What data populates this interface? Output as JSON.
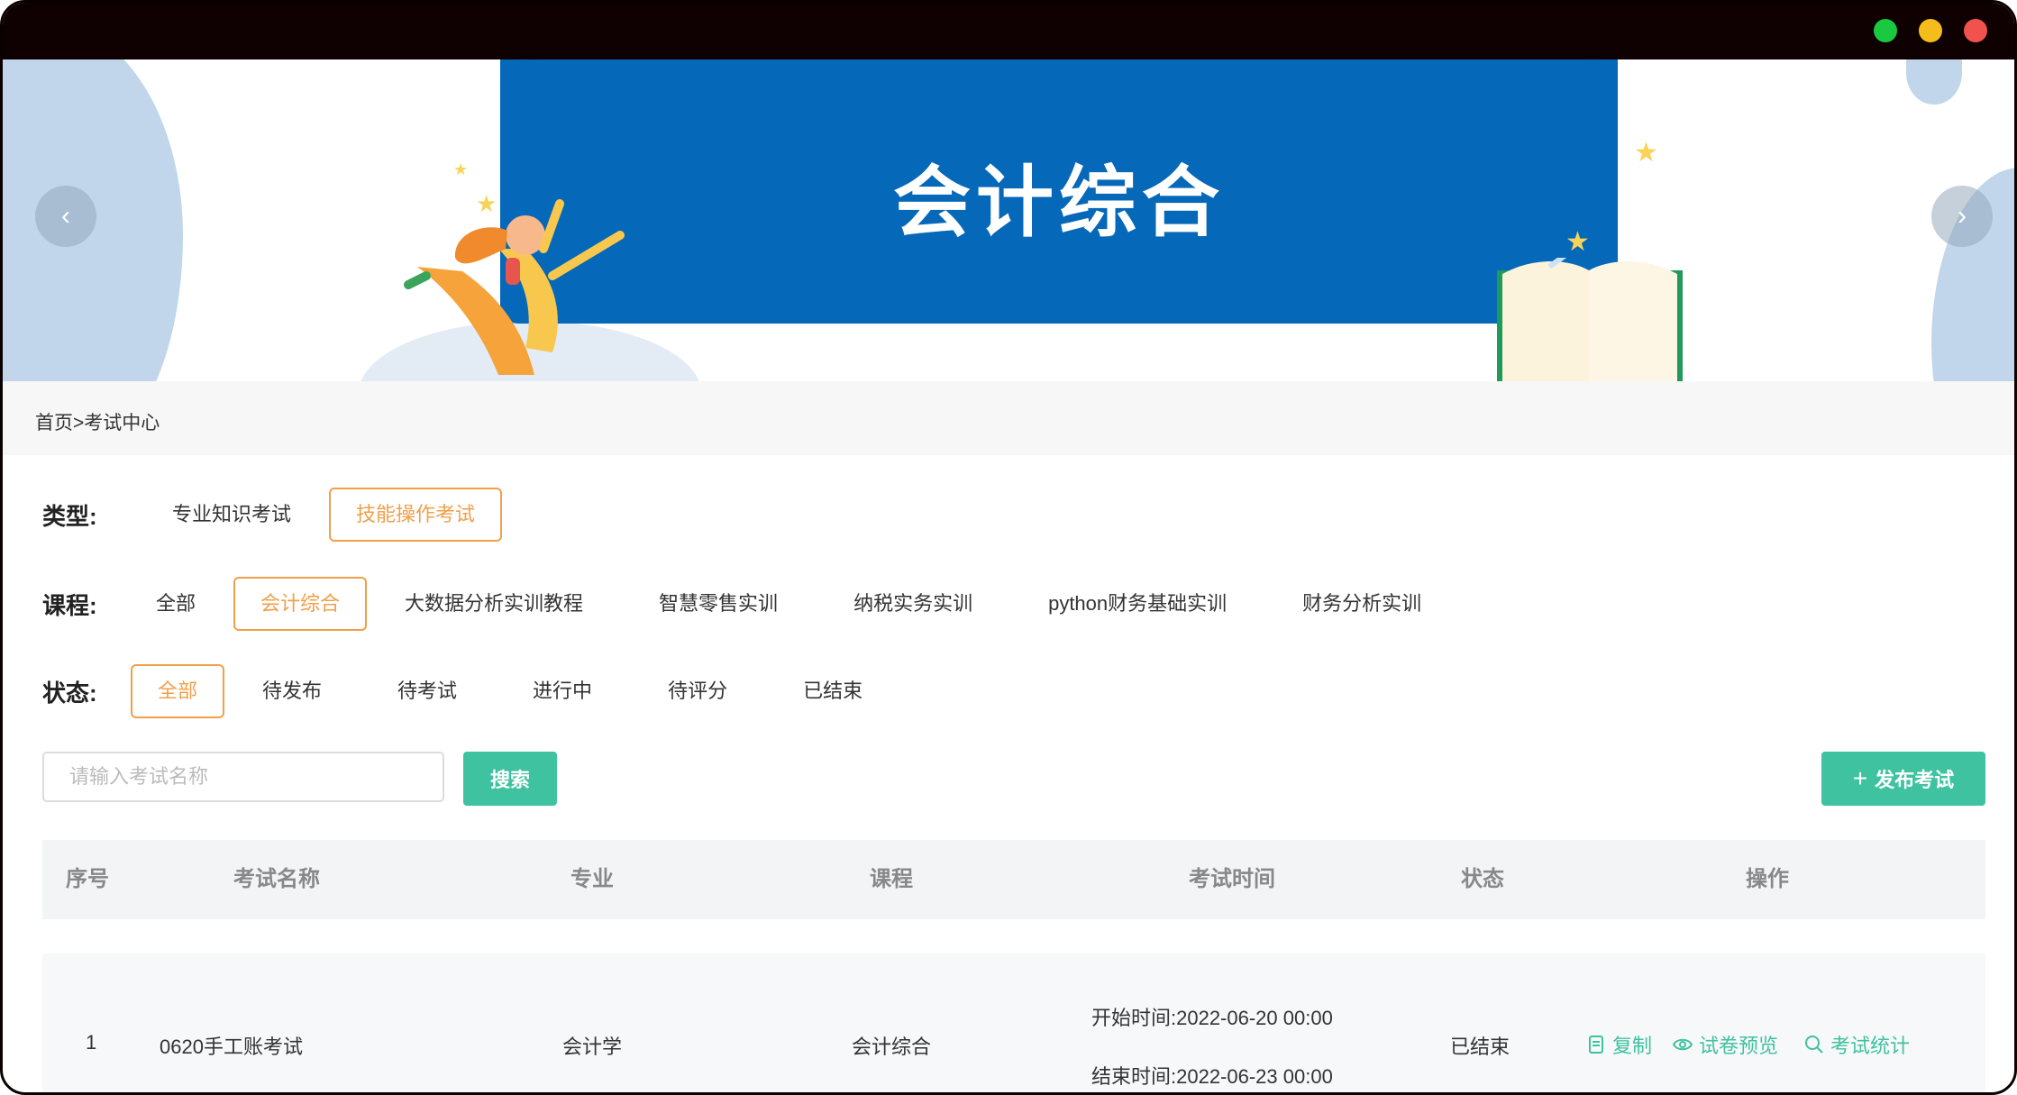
{
  "window": {
    "controls": [
      "green",
      "yellow",
      "red"
    ]
  },
  "banner": {
    "title": "会计综合",
    "prev": "‹",
    "next": "›"
  },
  "breadcrumb": {
    "text": "首页>考试中心"
  },
  "filters": {
    "type": {
      "label": "类型:",
      "options": [
        "专业知识考试",
        "技能操作考试"
      ],
      "selected": "技能操作考试"
    },
    "course": {
      "label": "课程:",
      "options": [
        "全部",
        "会计综合",
        "大数据分析实训教程",
        "智慧零售实训",
        "纳税实务实训",
        "python财务基础实训",
        "财务分析实训"
      ],
      "selected": "会计综合"
    },
    "status": {
      "label": "状态:",
      "options": [
        "全部",
        "待发布",
        "待考试",
        "进行中",
        "待评分",
        "已结束"
      ],
      "selected": "全部"
    }
  },
  "search": {
    "placeholder": "请输入考试名称",
    "value": "",
    "button": "搜索"
  },
  "publish": {
    "icon": "plus-icon",
    "label": "发布考试"
  },
  "table": {
    "headers": [
      "序号",
      "考试名称",
      "专业",
      "课程",
      "考试时间",
      "状态",
      "操作"
    ],
    "rows": [
      {
        "index": "1",
        "name": "0620手工账考试",
        "major": "会计学",
        "course": "会计综合",
        "start": "开始时间:2022-06-20 00:00",
        "end": "结束时间:2022-06-23 00:00",
        "status": "已结束",
        "actions": [
          {
            "icon": "copy-icon",
            "label": "复制"
          },
          {
            "icon": "eye-icon",
            "label": "试卷预览"
          },
          {
            "icon": "search-icon",
            "label": "考试统计"
          }
        ]
      }
    ]
  },
  "colors": {
    "accent": "#3fc2a0",
    "active_chip": "#f0a04a",
    "banner_blue": "#0568b8"
  }
}
